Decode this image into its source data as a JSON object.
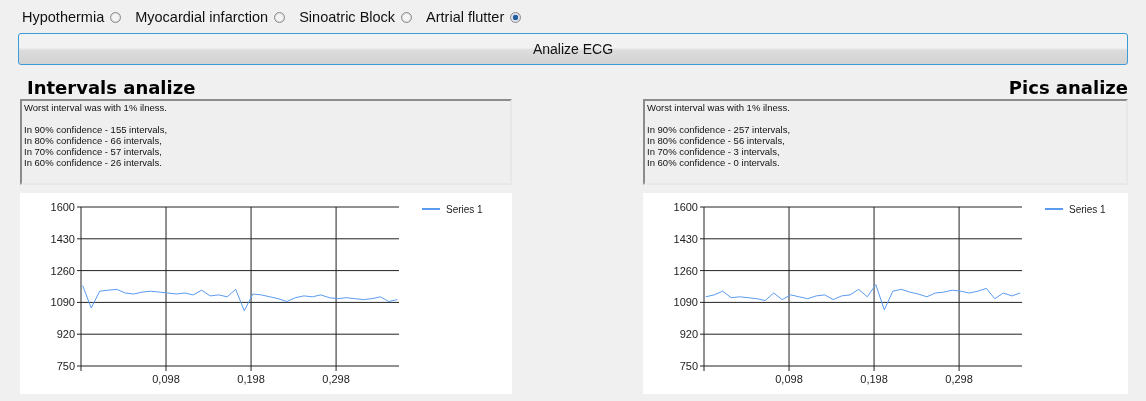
{
  "diagnoses": [
    {
      "label": "Hypothermia",
      "selected": false
    },
    {
      "label": "Myocardial infarction",
      "selected": false
    },
    {
      "label": "Sinoatric Block",
      "selected": false
    },
    {
      "label": "Artrial flutter",
      "selected": true
    }
  ],
  "analyze_button": "Analize ECG",
  "panels": [
    {
      "title": "Intervals analize",
      "lines": [
        "Worst interval was with 1% ilness.",
        "In 90% confidence - 155 intervals,",
        "In 80% confidence - 66 intervals,",
        "In 70% confidence - 57 intervals,",
        "In 60% confidence - 26 intervals."
      ],
      "chart_data": {
        "type": "line",
        "x": [
          0,
          0.01,
          0.02,
          0.03,
          0.04,
          0.05,
          0.06,
          0.07,
          0.08,
          0.09,
          0.1,
          0.11,
          0.12,
          0.13,
          0.14,
          0.15,
          0.16,
          0.17,
          0.18,
          0.19,
          0.2,
          0.21,
          0.22,
          0.23,
          0.24,
          0.25,
          0.26,
          0.27,
          0.28,
          0.29,
          0.3,
          0.31,
          0.32,
          0.33,
          0.34,
          0.35,
          0.36,
          0.37
        ],
        "series": [
          {
            "name": "Series 1",
            "color": "#5b9bf0",
            "values": [
              1180,
              1060,
              1150,
              1155,
              1160,
              1140,
              1135,
              1145,
              1150,
              1145,
              1140,
              1135,
              1140,
              1130,
              1155,
              1125,
              1130,
              1120,
              1160,
              1045,
              1135,
              1130,
              1120,
              1110,
              1095,
              1115,
              1125,
              1120,
              1130,
              1115,
              1110,
              1115,
              1110,
              1105,
              1110,
              1120,
              1095,
              1105
            ]
          }
        ],
        "xlim": [
          -0.002,
          0.372
        ],
        "ylim": [
          750,
          1600
        ],
        "grid": true,
        "xticks": [
          {
            "value": 0.098,
            "label": "0,098"
          },
          {
            "value": 0.198,
            "label": "0,198"
          },
          {
            "value": 0.298,
            "label": "0,298"
          }
        ],
        "yticks": [
          750,
          920,
          1090,
          1260,
          1430,
          1600
        ]
      }
    },
    {
      "title": "Pics analize",
      "lines": [
        "Worst interval was with 1% ilness.",
        "In 90% confidence - 257 intervals,",
        "In 80% confidence - 56 intervals,",
        "In 70% confidence - 3 intervals,",
        "In 60% confidence - 0 intervals."
      ],
      "chart_data": {
        "type": "line",
        "x": [
          0,
          0.01,
          0.02,
          0.03,
          0.04,
          0.05,
          0.06,
          0.07,
          0.08,
          0.09,
          0.1,
          0.11,
          0.12,
          0.13,
          0.14,
          0.15,
          0.16,
          0.17,
          0.18,
          0.19,
          0.2,
          0.21,
          0.22,
          0.23,
          0.24,
          0.25,
          0.26,
          0.27,
          0.28,
          0.29,
          0.3,
          0.31,
          0.32,
          0.33,
          0.34,
          0.35,
          0.36,
          0.37
        ],
        "series": [
          {
            "name": "Series 1",
            "color": "#5b9bf0",
            "values": [
              1120,
              1130,
              1150,
              1115,
              1120,
              1115,
              1110,
              1100,
              1140,
              1105,
              1130,
              1120,
              1110,
              1125,
              1130,
              1105,
              1125,
              1130,
              1160,
              1120,
              1185,
              1050,
              1150,
              1160,
              1145,
              1135,
              1120,
              1140,
              1145,
              1155,
              1150,
              1140,
              1150,
              1165,
              1110,
              1140,
              1125,
              1140
            ]
          }
        ],
        "xlim": [
          -0.002,
          0.372
        ],
        "ylim": [
          750,
          1600
        ],
        "grid": true,
        "xticks": [
          {
            "value": 0.098,
            "label": "0,098"
          },
          {
            "value": 0.198,
            "label": "0,198"
          },
          {
            "value": 0.298,
            "label": "0,298"
          }
        ],
        "yticks": [
          750,
          920,
          1090,
          1260,
          1430,
          1600
        ]
      }
    }
  ]
}
